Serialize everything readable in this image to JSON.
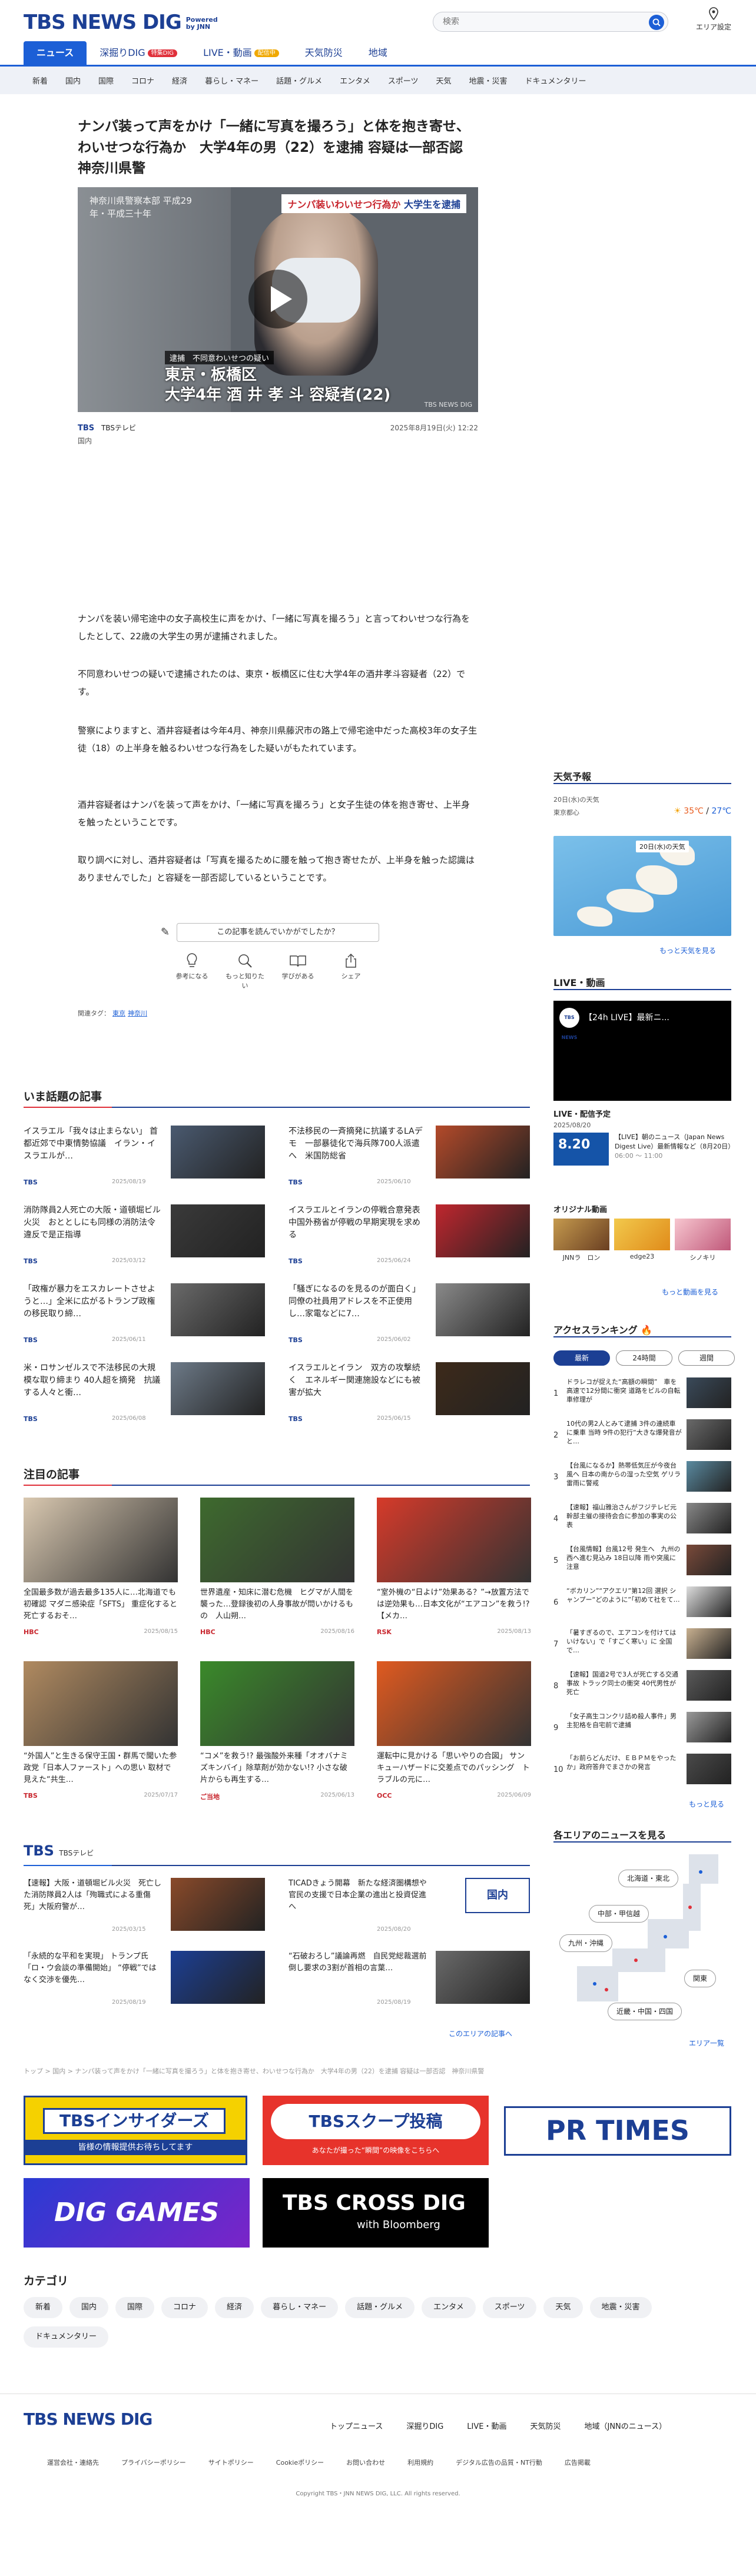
{
  "header": {
    "logo": "TBS NEWS DIG",
    "logo_powered": "Powered by JNN",
    "search_placeholder": "検索",
    "area_label": "エリア設定",
    "nav": [
      {
        "label": "ニュース"
      },
      {
        "label": "深掘りDIG",
        "badge": "特集DIG"
      },
      {
        "label": "LIVE・動画",
        "badge": "配信中"
      },
      {
        "label": "天気防災"
      },
      {
        "label": "地域"
      }
    ],
    "categories": [
      "新着",
      "国内",
      "国際",
      "コロナ",
      "経済",
      "暮らし・マネー",
      "話題・グルメ",
      "エンタメ",
      "スポーツ",
      "天気",
      "地震・災害",
      "ドキュメンタリー"
    ]
  },
  "article": {
    "title": "ナンパ装って声をかけ「一緒に写真を撮ろう」と体を抱き寄せ、わいせつな行為か　大学4年の男（22）を逮捕 容疑は一部否認　神奈川県警",
    "video": {
      "tag_red": "ナンパ装いわいせつ行為か",
      "tag_blue": "大学生を逮捕",
      "sign_text": "神奈川県警察本部 平成29年・平成三十年",
      "caption_small": "逮捕　不同意わいせつの疑い",
      "caption_large_1": "東京・板橋区",
      "caption_large_2": "大学4年 酒 井 孝 斗 容疑者(22)",
      "watermark": "TBS NEWS DIG"
    },
    "source": "TBS",
    "source_name": "TBSテレビ",
    "datetime": "2025年8月19日(火) 12:22",
    "category": "国内",
    "paragraphs": [
      "ナンパを装い帰宅途中の女子高校生に声をかけ、「一緒に写真を撮ろう」と言ってわいせつな行為をしたとして、22歳の大学生の男が逮捕されました。",
      "不同意わいせつの疑いで逮捕されたのは、東京・板橋区に住む大学4年の酒井孝斗容疑者（22）です。",
      "警察によりますと、酒井容疑者は今年4月、神奈川県藤沢市の路上で帰宅途中だった高校3年の女子生徒（18）の上半身を触るわいせつな行為をした疑いがもたれています。",
      "酒井容疑者はナンパを装って声をかけ、「一緒に写真を撮ろう」と女子生徒の体を抱き寄せ、上半身を触ったということです。",
      "取り調べに対し、酒井容疑者は「写真を撮るために腰を触って抱き寄せたが、上半身を触った認識はありませんでした」と容疑を一部否認しているということです。"
    ],
    "feedback_prompt": "この記事を読んでいかがでしたか？",
    "reactions": [
      "参考になる",
      "もっと知りたい",
      "学びがある",
      "シェア"
    ],
    "tags_label": "関連タグ：",
    "tags": [
      "東京",
      "神奈川"
    ]
  },
  "sidebar": {
    "weather_title": "天気予報",
    "weather_date": "20日(水)の天気",
    "weather_place": "東京都心",
    "weather_temp_high": "35℃",
    "weather_temp_low": "27℃",
    "weather_more": "もっと天気を見る",
    "live_title": "LIVE・動画",
    "live_video_title": "【24h LIVE】最新ニ...",
    "live_avatar": "TBS NEWS",
    "live_sched_title": "LIVE・配信予定",
    "live_sched_date": "2025/08/20",
    "live_item_time": "8.20",
    "live_item_text": "【LIVE】朝のニュース（Japan News Digest Live）最新情報など（8月20日）",
    "live_item_time2": "06:00 ～ 11:00",
    "original_title": "オリジナル動画",
    "originals": [
      "JNNラ　ロン",
      "edge23",
      "シノキリ"
    ],
    "video_more": "もっと動画を見る",
    "ranking_title": "アクセスランキング",
    "ranking_tabs": [
      "最新",
      "24時間",
      "週間"
    ],
    "ranking": [
      "ドラレコが捉えた“高額の瞬間”　車を高速で12分間に衝突 道路をビルの自転車修理が",
      "10代の男2人とみて逮捕 3件の連続車に乗車 当時 9件の犯行“大きな爆発音がと…",
      "【台風になるか】熱帯低気圧が今夜台風へ 日本の南からの湿った空気 ゲリラ雷雨に警戒",
      "【速報】福山雅治さんがフジテレビ元幹部主催の接待会合に参加の事実の公表",
      "【台風情報】台風12号 発生へ　九州の西へ進む見込み 18日以降 雨や突風に注意",
      "“ボカリン”“アクエリ”第12回 選択 シャンプー“どのように”「初めて社をて…",
      "「暑すぎるので、エアコンを付けてはいけない」で「すごく寒い」に 全国で…",
      "【速報】国道2号で3人が死亡する交通事故 トラック同士の衝突 40代男性が死亡",
      "「女子高生コンクリ詰め殺人事件」男主犯格を自宅前で逮捕",
      "「お前らどんだけ、ＥＢＰＭをやったか」政府答弁でまさかの発言"
    ],
    "ranking_more": "もっと見る",
    "area_title": "各エリアのニュースを見る",
    "areas": [
      "北海道・東北",
      "中部・甲信越",
      "九州・沖縄",
      "関東",
      "近畿・中国・四国"
    ],
    "area_more": "エリア一覧"
  },
  "hot": {
    "title": "いま話題の記事",
    "items": [
      {
        "text": "イスラエル「我々は止まらない」 首都近郊で中東情勢協議　イラン・イスラエルが…",
        "media": "TBS",
        "date": "2025/08/19"
      },
      {
        "text": "不法移民の一斉摘発に抗議するLAデモ　一部暴徒化で海兵隊700人派遣へ　米国防総省",
        "media": "TBS",
        "date": "2025/06/10"
      },
      {
        "text": "消防隊員2人死亡の大阪・道頓堀ビル火災　おととしにも同様の消防法令違反で是正指導",
        "media": "TBS",
        "date": "2025/03/12"
      },
      {
        "text": "イスラエルとイランの停戦合意発表　中国外務省が停戦の早期実現を求める",
        "media": "TBS",
        "date": "2025/06/24"
      },
      {
        "text": "「政権が暴力をエスカレートさせようと…」全米に広がるトランプ政権の移民取り締…",
        "media": "TBS",
        "date": "2025/06/11"
      },
      {
        "text": "「騒ぎになるのを見るのが面白く」同僚の社員用アドレスを不正使用し…家電などに7…",
        "media": "TBS",
        "date": "2025/06/02"
      },
      {
        "text": "米・ロサンゼルスで不法移民の大規模な取り締まり 40人超を摘発　抗議する人々と衝…",
        "media": "TBS",
        "date": "2025/06/08"
      },
      {
        "text": "イスラエルとイラン　双方の攻撃続く　エネルギー関連施設などにも被害が拡大",
        "media": "TBS",
        "date": "2025/06/15"
      }
    ]
  },
  "featured": {
    "title": "注目の記事",
    "items": [
      {
        "text": "全国最多数が過去最多135人に…北海道でも初確認 マダニ感染症「SFTS」 重症化すると死亡するおそ…",
        "media": "HBC",
        "date": "2025/08/15"
      },
      {
        "text": "世界遺産・知床に潜む危機　ヒグマが人間を襲った…登録後初の人身事故が問いかけるもの　人山朔…",
        "media": "HBC",
        "date": "2025/08/16"
      },
      {
        "text": "“室外機の“日よけ”効果ある？”→放置方法では逆効果も…日本文化が“エアコン”を救う!?【メカ…",
        "media": "RSK",
        "date": "2025/08/13"
      },
      {
        "text": "“外国人”と生きる保守王国・群馬で聞いた参政党「日本人ファースト」への思い 取材で見えた“共生…",
        "media": "TBS",
        "date": "2025/07/17"
      },
      {
        "text": "“コメ”を救う!? 最強酸外来種「オオバナミズキンバイ」除草剤が効かない!? 小さな破片からも再生する…",
        "media": "ご当地",
        "date": "2025/06/13"
      },
      {
        "text": "運転中に見かける「思いやりの合図」 サンキューハザードに交差点でのパッシング　トラブルの元に…",
        "media": "OCC",
        "date": "2025/06/09"
      }
    ]
  },
  "tbs_sec": {
    "title": "TBS",
    "subtitle": "TBSテレビ",
    "items": [
      {
        "text": "【速報】大阪・道頓堀ビル火災　死亡した消防隊員2人は「殉職式による重傷死」大阪府警が…",
        "date": "2025/03/15"
      },
      {
        "text": "TICADきょう開幕　新たな経済圏構想や官民の支援で日本企業の進出と投資促進へ",
        "date": "2025/08/20"
      },
      {
        "text": "「永続的な平和を実現」 トランプ氏「ロ・ウ会談の準備開始」 “停戦”ではなく交渉を優先…",
        "date": "2025/08/19"
      },
      {
        "text": "“石破おろし”議論再燃　自民党総裁選前倒し要求の3割が首相の言葉…",
        "date": "2025/08/19"
      }
    ],
    "domestic_label": "国内",
    "more": "このエリアの記事へ"
  },
  "breadcrumb": "トップ > 国内 > ナンパ装って声をかけ「一緒に写真を撮ろう」と体を抱き寄せ、わいせつな行為か　大学4年の男（22）を逮捕 容疑は一部否認　神奈川県警",
  "banners": {
    "insiders_title": "TBSインサイダーズ",
    "insiders_sub": "皆様の情報提供お待ちしてます",
    "scoop_title": "TBSスクープ投稿",
    "scoop_sub": "あなたが撮った“瞬間”の映像をこちらへ",
    "prtimes": "PR TIMES",
    "diggames": "DIG GAMES",
    "crossdig": "TBS CROSS DIG",
    "crossdig_sub": "with Bloomberg"
  },
  "category_section": {
    "title": "カテゴリ",
    "items": [
      "新着",
      "国内",
      "国際",
      "コロナ",
      "経済",
      "暮らし・マネー",
      "話題・グルメ",
      "エンタメ",
      "スポーツ",
      "天気",
      "地震・災害",
      "ドキュメンタリー"
    ]
  },
  "footer": {
    "logo": "TBS NEWS DIG",
    "links1": [
      "トップニュース",
      "深掘りDIG",
      "LIVE・動画",
      "天気防災",
      "地域（JNNのニュース）"
    ],
    "links2": [
      "運営会社・連絡先",
      "プライバシーポリシー",
      "サイトポリシー",
      "Cookieポリシー",
      "お問い合わせ",
      "利用規約",
      "デジタル広告の品質・NT行動",
      "広告掲載"
    ],
    "copyright": "Copyright TBS・JNN NEWS DIG, LLC. All rights reserved."
  }
}
